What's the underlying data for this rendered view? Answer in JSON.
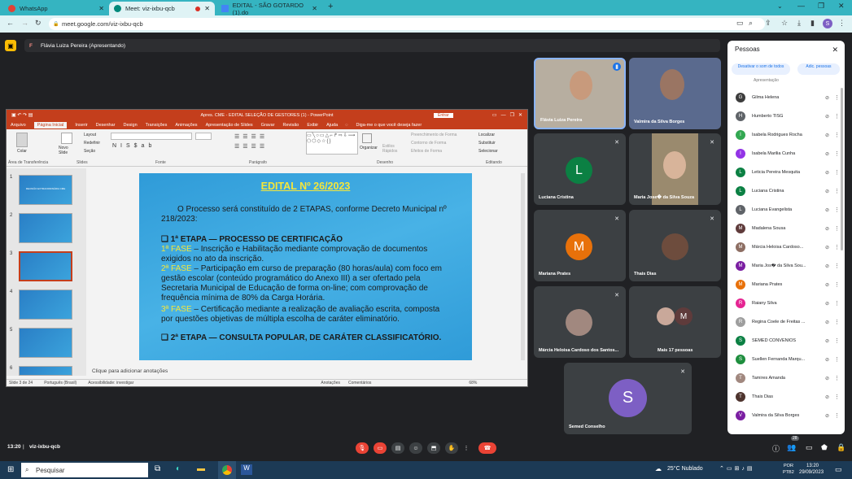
{
  "browser": {
    "tabs": [
      {
        "title": "WhatsApp",
        "icon": "whatsapp-icon",
        "color": "#e14235"
      },
      {
        "title": "Meet: viz-ixbu-qcb",
        "icon": "meet-icon",
        "color": "#00897b"
      },
      {
        "title": "EDITAL - SÃO GOTARDO (1).do",
        "icon": "docs-icon",
        "color": "#4285f4"
      }
    ],
    "url": "meet.google.com/viz-ixbu-qcb",
    "profile_initial": "S"
  },
  "presenter": {
    "initial": "F",
    "label": "Flávia Luiza Pereira (Apresentando)"
  },
  "powerpoint": {
    "title": "Apres. CME - EDITAL SELEÇÃO DE GESTORES (1) - PowerPoint",
    "signin": "Entrar",
    "tabs": [
      "Arquivo",
      "Página Inicial",
      "Inserir",
      "Desenhar",
      "Design",
      "Transições",
      "Animações",
      "Apresentação de Slides",
      "Gravar",
      "Revisão",
      "Exibir",
      "Ajuda"
    ],
    "tell_me": "Diga-me o que você deseja fazer",
    "groups": [
      "Área de Transferência",
      "Slides",
      "Fonte",
      "Parágrafo",
      "Desenho",
      "Editando"
    ],
    "ribbon_labels": {
      "colar": "Colar",
      "novo_slide": "Novo Slide",
      "layout": "Layout",
      "redefinir": "Redefinir",
      "secao": "Seção",
      "organizar": "Organizar",
      "estilos": "Estilos Rápidos",
      "preenchimento": "Preenchimento de Forma",
      "contorno": "Contorno de Forma",
      "efeitos": "Efeitos de Forma",
      "localizar": "Localizar",
      "substituir": "Substituir",
      "selecionar": "Selecionar"
    },
    "thumb_numbers": [
      "1",
      "2",
      "3",
      "4",
      "5",
      "6"
    ],
    "thumb1_text": "REUNIÃO EXTRAORDINÁRIA CME",
    "slide": {
      "title": "EDITAL Nº 26/2023",
      "intro": "O Processo será constituído de 2 ETAPAS, conforme Decreto Municipal nº 218/2023:",
      "etapa1": "❑ 1ª ETAPA — PROCESSO DE CERTIFICAÇÃO",
      "fase1_label": "1ª FASE",
      "fase1_text": " – Inscrição e Habilitação mediante comprovação de documentos exigidos no ato da inscrição.",
      "fase2_label": "2ª FASE",
      "fase2_text": " – Participação em curso de preparação (80 horas/aula) com foco em gestão escolar (conteúdo programático do Anexo III) a ser ofertado pela Secretaria Municipal de Educação de forma on-line; com comprovação de frequência mínima de 80% da Carga Horária.",
      "fase3_label": "3ª FASE",
      "fase3_text": " – Certificação mediante a realização de avaliação escrita, composta por questões objetivas de múltipla escolha de caráter eliminatório.",
      "etapa2": "❑ 2ª ETAPA — CONSULTA POPULAR, DE CARÁTER CLASSIFICATÓRIO."
    },
    "notes_placeholder": "Clique para adicionar anotações",
    "status": {
      "slide": "Slide 3 de 24",
      "lang": "Português (Brasil)",
      "access": "Acessibilidade: investigar",
      "anotacoes": "Anotações",
      "comentarios": "Comentários",
      "zoom": "68%"
    }
  },
  "tiles": [
    {
      "name": "Flávia Luiza Pereira"
    },
    {
      "name": "Valmira da Silva Borges"
    },
    {
      "name": "Luciana Cristina",
      "initial": "L",
      "color": "#0b8043"
    },
    {
      "name": "Maria Jose� da Silva Souza"
    },
    {
      "name": "Mariana Prates",
      "initial": "M",
      "color": "#e8710a"
    },
    {
      "name": "Thais Dias"
    },
    {
      "name": "Márcia Heloisa Cardoso dos Santos..."
    },
    {
      "name": "Mais 17 pessoas",
      "initial": "M",
      "color": "#5f3b3b"
    },
    {
      "name": "Semed Conselho",
      "initial": "S",
      "color": "#7d5fc4"
    }
  ],
  "people_panel": {
    "title": "Pessoas",
    "mute_all": "Desativar o som de todos",
    "add": "Adic. pessoas",
    "top_cut": "Apresentação",
    "list": [
      {
        "name": "Gilma Helena",
        "initial": "G",
        "color": "#3c3c3c"
      },
      {
        "name": "Humberto TISG",
        "initial": "H",
        "color": "#5f6368"
      },
      {
        "name": "Isabela Rodrigues Rocha",
        "initial": "I",
        "color": "#33a852"
      },
      {
        "name": "Isabela Marilia Cunha",
        "initial": "I",
        "color": "#9334e6"
      },
      {
        "name": "Leticia Pereira Mesquita",
        "initial": "L",
        "color": "#0b8043"
      },
      {
        "name": "Luciana Cristina",
        "initial": "L",
        "color": "#0b8043"
      },
      {
        "name": "Luciana Evangelista",
        "initial": "L",
        "color": "#5f6368"
      },
      {
        "name": "Madalena Sousa",
        "initial": "M",
        "color": "#5f3b3b"
      },
      {
        "name": "Márcia Heloisa Cardoso...",
        "initial": "M",
        "color": "#8d6e63"
      },
      {
        "name": "Maria Jos� da Silva Sou...",
        "initial": "M",
        "color": "#7b1fa2"
      },
      {
        "name": "Mariana Prates",
        "initial": "M",
        "color": "#e8710a"
      },
      {
        "name": "Raiany Silva",
        "initial": "R",
        "color": "#e52592"
      },
      {
        "name": "Regina Coele de Freitas ...",
        "initial": "R",
        "color": "#9e9e9e"
      },
      {
        "name": "SEMED CONVÊNIOS",
        "initial": "S",
        "color": "#0b8043"
      },
      {
        "name": "Suellen Fernanda Marqu...",
        "initial": "S",
        "color": "#1e8e3e"
      },
      {
        "name": "Tamires Amanda",
        "initial": "T",
        "color": "#a1887f"
      },
      {
        "name": "Thais Dias",
        "initial": "T",
        "color": "#4e342e"
      },
      {
        "name": "Valmira da Silva Borges",
        "initial": "V",
        "color": "#7b1fa2"
      }
    ]
  },
  "meet_footer": {
    "time": "13:20",
    "code": "viz-ixbu-qcb",
    "participants_badge": "28"
  },
  "taskbar": {
    "search": "Pesquisar",
    "weather": "25°C  Nublado",
    "lang": "POR",
    "kb": "PTB2",
    "time": "13:20",
    "date": "29/09/2023"
  }
}
